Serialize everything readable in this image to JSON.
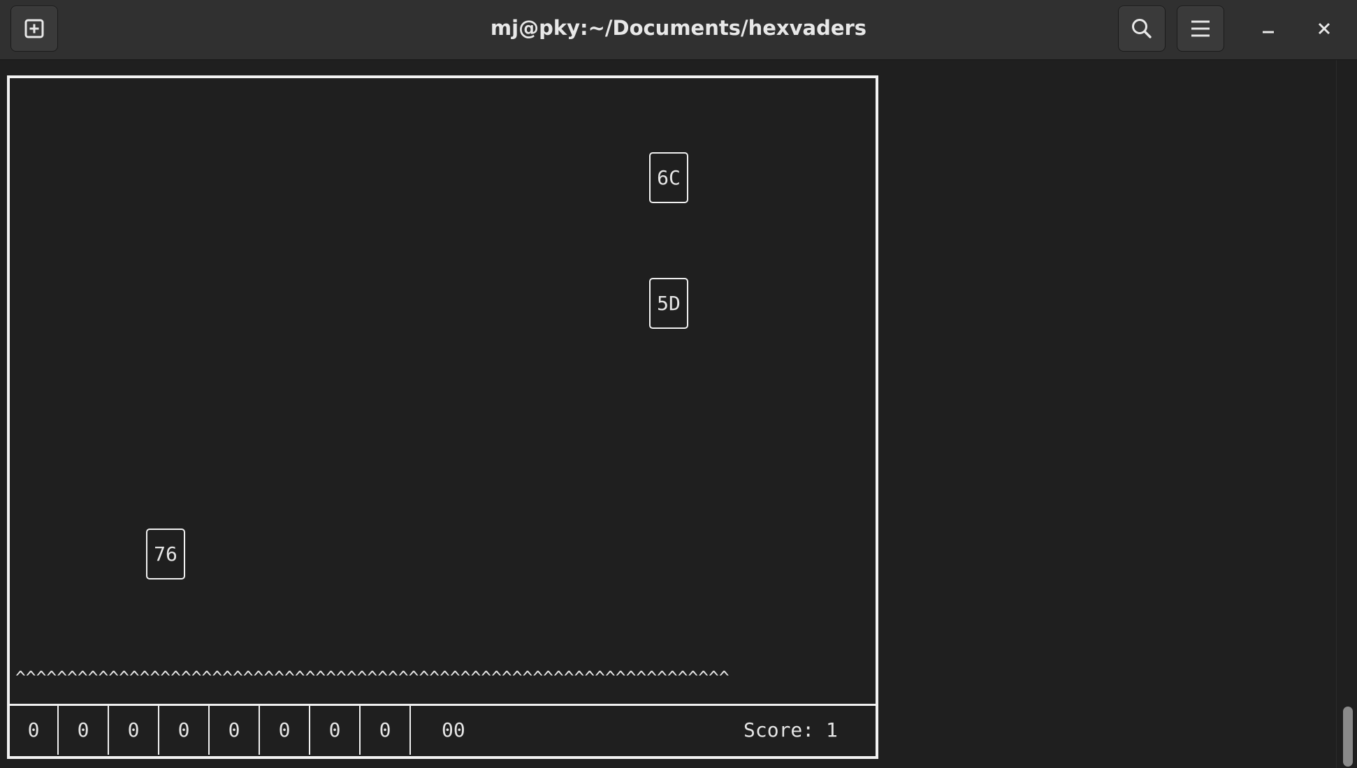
{
  "window": {
    "title": "mj@pky:~/Documents/hexvaders"
  },
  "header": {
    "new_tab_icon": "new-tab-icon",
    "search_icon": "search-icon",
    "menu_icon": "hamburger-menu-icon",
    "minimize_icon": "minimize-icon",
    "close_icon": "close-icon"
  },
  "game": {
    "invaders": [
      {
        "label": "6C"
      },
      {
        "label": "5D"
      },
      {
        "label": "76"
      }
    ],
    "spikes": "^^^^^^^^^^^^^^^^^^^^^^^^^^^^^^^^^^^^^^^^^^^^^^^^^^^^^^^^^^^^^^^^^^^^^",
    "bits": [
      "0",
      "0",
      "0",
      "0",
      "0",
      "0",
      "0",
      "0"
    ],
    "hex_value": "00",
    "score": "Score: 1"
  },
  "colors": {
    "background": "#1f1f1f",
    "headerbar": "#303030",
    "foreground": "#e6e6e6",
    "scroll_thumb": "#8a8a8a"
  }
}
